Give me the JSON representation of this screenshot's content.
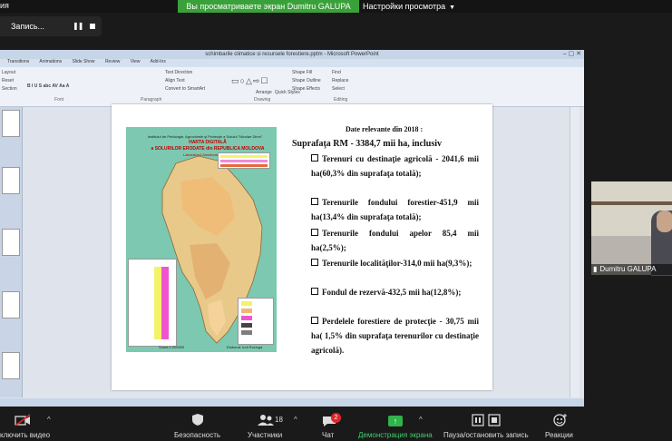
{
  "top": {
    "system_label": "ия",
    "share_banner": "Вы просматриваете экран Dumitru GALUPA",
    "view_options": "Настройки просмотра"
  },
  "recording": {
    "label": "Запись..."
  },
  "ppt": {
    "title": "schimbarile climatice si resursele forestiere.pptm - Microsoft PowerPoint",
    "tabs": [
      "Transitions",
      "Animations",
      "Slide Show",
      "Review",
      "View",
      "Add-Ins"
    ],
    "ribbon": {
      "layout": "Layout",
      "reset": "Reset",
      "section": "Section",
      "text_direction": "Text Direction",
      "align_text": "Align Text",
      "convert_smartart": "Convert to SmartArt",
      "arrange": "Arrange",
      "quick_styles": "Quick Styles",
      "shape_fill": "Shape Fill",
      "shape_outline": "Shape Outline",
      "shape_effects": "Shape Effects",
      "find": "Find",
      "replace": "Replace",
      "select": "Select",
      "group_font": "Font",
      "group_paragraph": "Paragraph",
      "group_drawing": "Drawing",
      "group_editing": "Editing"
    }
  },
  "slide": {
    "heading": "Date relevante din  2018 :",
    "total": "Suprafaţa RM - 3384,7 mii ha, inclusiv",
    "bullets": [
      "Terenuri cu destinaţie agricolă - 2041,6 mii ha(60,3% din suprafaţa totală);",
      "Terenurile fondului forestier-451,9 mii ha(13,4% din suprafaţa totală);",
      "Terenurile fondului apelor 85,4 mii ha(2,5%);",
      "Terenurile localităţilor-314,0 mii ha(9,3%);",
      "Fondul de rezervă-432,5 mii ha(12,8%);",
      "Perdelele forestiere de protecţie - 30,75 mii ha( 1,5% din suprafaţa terenurilor cu destinaţie agricolă)."
    ],
    "map": {
      "institute": "Institutul de Pedologie, Agrochimie şi Protecţie a Solului \"Nicolae Dimo\"",
      "title": "HARTA DIGITALĂ",
      "subtitle": "a SOLURILOR ERODATE din REPUBLICA MOLDOVA",
      "lab": "Laboratorul Ameliorarea Solului",
      "scale": "Scara 1:200000",
      "author": "Elaborat: Iurii Rozloga"
    }
  },
  "participant": {
    "name": "Dumitru GALUPA"
  },
  "toolbar": {
    "video": "ключить видео",
    "security": "Безопасность",
    "participants": "Участники",
    "participants_count": "18",
    "chat": "Чат",
    "chat_badge": "2",
    "share": "Демонстрация экрана",
    "recording": "Пауза/остановить запись",
    "reactions": "Реакции"
  },
  "colors": {
    "share_green": "#3aa13a",
    "badge_red": "#e0262b",
    "map_teal": "#7dc8b0"
  }
}
